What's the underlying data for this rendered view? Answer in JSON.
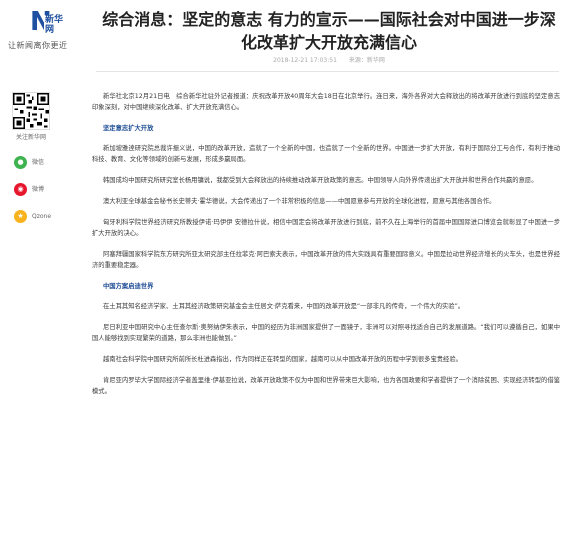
{
  "logo": {
    "mark": "N",
    "brand": "新华网",
    "slogan": "让新闻离你更近"
  },
  "article": {
    "title": "综合消息：坚定的意志 有力的宣示——国际社会对中国进一步深化改革扩大开放充满信心",
    "date": "2018-12-21 17:03:51",
    "source": "来源：新华网",
    "paragraphs": [
      {
        "type": "p",
        "text": "新华社北京12月21日电　综合新华社驻外记者报道：庆祝改革开放40周年大会18日在北京举行。连日来，海外各界对大会释放出的将改革开放进行到底的坚定意志印象深刻，对中国继续深化改革、扩大开放充满信心。"
      },
      {
        "type": "sub",
        "text": "坚定意志扩大开放"
      },
      {
        "type": "p",
        "text": "新加坡雅逹研究院总裁许振义说，中国的改革开放，造就了一个全新的中国，也造就了一个全新的世界。中国进一步扩大开放，有利于国际分工与合作，有利于推动科技、教育、文化等领域的创新与发展，形成多赢局面。"
      },
      {
        "type": "p",
        "text": "韩国成均中国研究所研究室长杨用镛说，我都受到大会释放出的持续推动改革开放政策的意志。中国领导人向外界传递出扩大开放并和世界合作共赢的意愿。"
      },
      {
        "type": "p",
        "text": "澳大利亚全球基金会秘书长史蒂夫·霍华德说，大会传递出了一个非常积极的信息——中国愿意参与开放的全球化进程，愿意与其他各国合作。"
      },
      {
        "type": "p",
        "text": "匈牙利科学院世界经济研究所教授伊诺·玛伊伊 安德拉什说，相信中国定会将改革开放进行到底，前不久在上海举行的首届中国国际进口博览会就彰显了中国进一步扩大开放的决心。"
      },
      {
        "type": "p",
        "text": "阿塞拜疆国家科学院东方研究所亚太研究部主任拉菲克·阿巴索夫表示，中国改革开放的伟大实践具有重要国际意义。中国是拉动世界经济增长的火车头，也是世界经济的重要稳定器。"
      },
      {
        "type": "sub",
        "text": "中国方案启迪世界"
      },
      {
        "type": "p",
        "text": "在土耳其知名经济学家、土耳其经济政策研究基金会主任居文·萨克看来，中国的改革开放是“一部非凡的传奇，一个伟大的实验”。"
      },
      {
        "type": "p",
        "text": "尼日利亚中国研究中心主任查尔斯·奥努纳伊朱表示，中国的经历为非洲国家提供了一面镜子，非洲可以对照寻找适合自己的发展道路。“我们可以遵循自己，如果中国人能够找到实现繁荣的道路，那么非洲也能做到。”"
      },
      {
        "type": "p",
        "text": "越南社会科学院中国研究所前所长杜进森指出，作为同样正在转型的国家，越南可以从中国改革开放的历程中学到很多宝贵经验。"
      },
      {
        "type": "p",
        "text": "肯尼亚内罗毕大学国际经济学者盖里维·伊基亚拉说，改革开放政策不仅为中国和世界带来巨大影响，也为各国政要和学者提供了一个消除贫困、实现经济转型的借鉴模式。"
      }
    ]
  },
  "sidebar": {
    "follow_label": "关注新华网",
    "share": [
      {
        "label": "微信",
        "icon": "wechat-icon",
        "color": "#3fb34f",
        "glyph": "●"
      },
      {
        "label": "微博",
        "icon": "weibo-icon",
        "color": "#e6162d",
        "glyph": "◉"
      },
      {
        "label": "Qzone",
        "icon": "qzone-icon",
        "color": "#f7b21e",
        "glyph": "★"
      }
    ]
  }
}
